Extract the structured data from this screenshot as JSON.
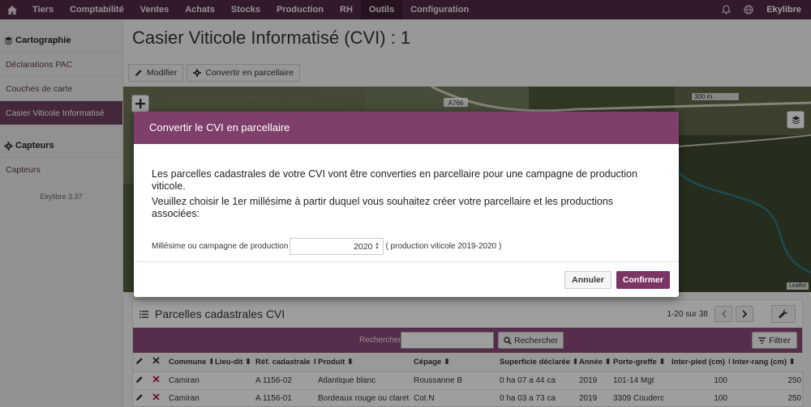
{
  "colors": {
    "brand": "#532b46",
    "accent": "#7f3f6b",
    "search_bar": "#8c4a78"
  },
  "topnav": {
    "items": [
      "Tiers",
      "Comptabilité",
      "Ventes",
      "Achats",
      "Stocks",
      "Production",
      "RH",
      "Outils",
      "Configuration"
    ],
    "active": "Outils",
    "user": "Ekylibre"
  },
  "sidebar": {
    "section1": "Cartographie",
    "items1": [
      "Déclarations PAC",
      "Couches de carte",
      "Casier Viticole Informatisé"
    ],
    "section2": "Capteurs",
    "items2": [
      "Capteurs"
    ],
    "version": "Ekylibre 3.37"
  },
  "page": {
    "title": "Casier Viticole Informatisé (CVI) : 1",
    "modify_label": "Modifier",
    "convert_label": "Convertir en parcellaire"
  },
  "map": {
    "road_label": "A766",
    "scale_label": "300 m",
    "attribution": "Leaflet"
  },
  "table": {
    "title": "Parcelles cadastrales CVI",
    "pagination": "1-20 sur 38",
    "search_label": "Rechercher",
    "search_button": "Rechercher",
    "filter_button": "Filtrer",
    "columns": [
      "Commune",
      "Lieu-dit",
      "Réf. cadastrale",
      "Produit",
      "Cépage",
      "Superficie déclarée",
      "Année",
      "Porte-greffe",
      "Inter-pied (cm)",
      "Inter-rang (cm)"
    ],
    "rows": [
      [
        "Camiran",
        "",
        "A 1156-02",
        "Atlantique blanc",
        "Roussanne B",
        "0 ha 07 a 44 ca",
        "2019",
        "101-14 Mgt",
        "100",
        "250"
      ],
      [
        "Camiran",
        "",
        "A 1156-01",
        "Bordeaux rouge ou claret",
        "Cot N",
        "0 ha 03 a 73 ca",
        "2019",
        "3309 Couderc",
        "100",
        "250"
      ]
    ]
  },
  "modal": {
    "title": "Convertir le CVI en parcellaire",
    "text1": "Les parcelles cadastrales de votre CVI vont être converties en parcellaire pour une campagne de production viticole.",
    "text2": "Veuillez choisir le 1er millésime à partir duquel vous souhaitez créer votre parcellaire et les productions associées:",
    "field_label": "Millésime ou campagne de production",
    "year_value": "2020",
    "hint_prefix": "( production viticole",
    "hint_range": "2019-2020",
    "hint_suffix": ")",
    "cancel_label": "Annuler",
    "confirm_label": "Confirmer"
  }
}
